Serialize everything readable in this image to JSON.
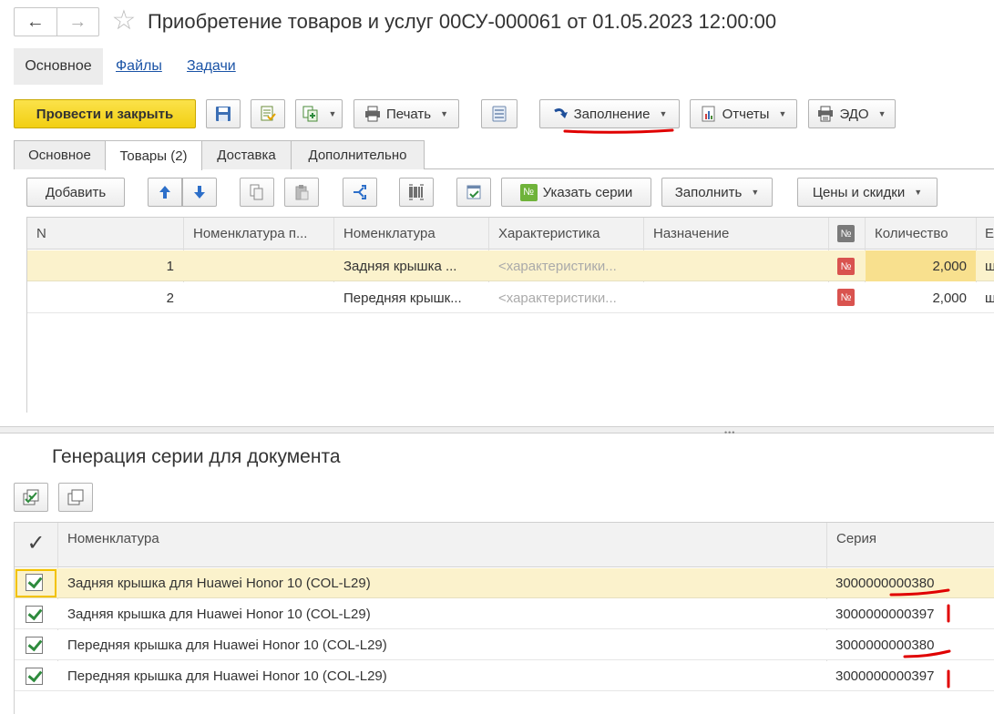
{
  "window": {
    "title": "Приобретение товаров и услуг 00СУ-000061 от 01.05.2023 12:00:00"
  },
  "nav_links": [
    {
      "label": "Основное",
      "active": true
    },
    {
      "label": "Файлы",
      "active": false
    },
    {
      "label": "Задачи",
      "active": false
    }
  ],
  "toolbar": {
    "post_close": "Провести и закрыть",
    "print": "Печать",
    "fill": "Заполнение",
    "reports": "Отчеты",
    "edo": "ЭДО"
  },
  "tabs": [
    {
      "label": "Основное"
    },
    {
      "label": "Товары (2)"
    },
    {
      "label": "Доставка"
    },
    {
      "label": "Дополнительно"
    }
  ],
  "goods_toolbar": {
    "add": "Добавить",
    "set_series": "Указать серии",
    "fill": "Заполнить",
    "prices": "Цены и скидки"
  },
  "goods_table": {
    "headers": [
      "N",
      "Номенклатура п...",
      "Номенклатура",
      "Характеристика",
      "Назначение",
      "№",
      "Количество",
      "Е"
    ],
    "rows": [
      {
        "n": "1",
        "nom_p": "",
        "nom": "Задняя крышка ...",
        "char": "<характеристики...",
        "purpose": "",
        "badge": "№",
        "qty": "2,000",
        "unit": "ш"
      },
      {
        "n": "2",
        "nom_p": "",
        "nom": "Передняя крышк...",
        "char": "<характеристики...",
        "purpose": "",
        "badge": "№",
        "qty": "2,000",
        "unit": "ш"
      }
    ]
  },
  "series_panel": {
    "title": "Генерация серии для документа",
    "headers": {
      "check": "✓",
      "nom": "Номенклатура",
      "series": "Серия"
    },
    "rows": [
      {
        "nom": "Задняя крышка для Huawei Honor 10 (COL-L29)",
        "series": "3000000000380"
      },
      {
        "nom": "Задняя крышка для Huawei Honor 10 (COL-L29)",
        "series": "3000000000397"
      },
      {
        "nom": "Передняя крышка для Huawei Honor 10 (COL-L29)",
        "series": "3000000000380"
      },
      {
        "nom": "Передняя крышка для Huawei Honor 10 (COL-L29)",
        "series": "3000000000397"
      }
    ]
  },
  "colors": {
    "accent_yellow": "#f5d81a",
    "row_highlight": "#fbf2cc",
    "badge_red": "#d9534f",
    "annotation_red": "#e00000"
  }
}
